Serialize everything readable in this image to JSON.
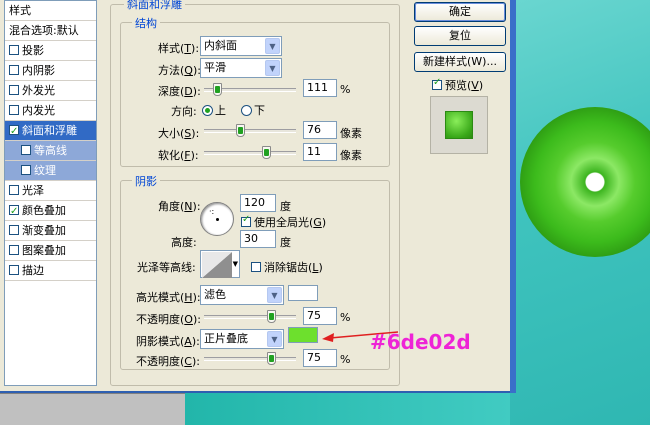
{
  "window": {
    "style_list": [
      {
        "label": "样式",
        "checkbox": null,
        "selected": false,
        "sub": false
      },
      {
        "label": "混合选项:默认",
        "checkbox": null,
        "selected": false,
        "sub": false
      },
      {
        "label": "投影",
        "checkbox": false,
        "selected": false,
        "sub": false
      },
      {
        "label": "内阴影",
        "checkbox": false,
        "selected": false,
        "sub": false
      },
      {
        "label": "外发光",
        "checkbox": false,
        "selected": false,
        "sub": false
      },
      {
        "label": "内发光",
        "checkbox": false,
        "selected": false,
        "sub": false
      },
      {
        "label": "斜面和浮雕",
        "checkbox": true,
        "selected": true,
        "sub": false
      },
      {
        "label": "等高线",
        "checkbox": false,
        "selected": false,
        "sub": true
      },
      {
        "label": "纹理",
        "checkbox": false,
        "selected": false,
        "sub": true
      },
      {
        "label": "光泽",
        "checkbox": false,
        "selected": false,
        "sub": false
      },
      {
        "label": "颜色叠加",
        "checkbox": true,
        "selected": false,
        "sub": false
      },
      {
        "label": "渐变叠加",
        "checkbox": false,
        "selected": false,
        "sub": false
      },
      {
        "label": "图案叠加",
        "checkbox": false,
        "selected": false,
        "sub": false
      },
      {
        "label": "描边",
        "checkbox": false,
        "selected": false,
        "sub": false
      }
    ]
  },
  "bevel": {
    "group_title": "斜面和浮雕",
    "structure_title": "结构",
    "style_label": "样式",
    "style_key": "T",
    "style_value": "内斜面",
    "technique_label": "方法",
    "technique_key": "Q",
    "technique_value": "平滑",
    "depth_label": "深度",
    "depth_key": "D",
    "depth_value": "111",
    "depth_unit": "%",
    "direction_label": "方向:",
    "direction_up": "上",
    "direction_down": "下",
    "direction_selected": "上",
    "size_label": "大小",
    "size_key": "S",
    "size_value": "76",
    "size_unit": "像素",
    "soften_label": "软化",
    "soften_key": "F",
    "soften_value": "11",
    "soften_unit": "像素"
  },
  "shading": {
    "title": "阴影",
    "angle_label": "角度",
    "angle_key": "N",
    "angle_value": "120",
    "angle_unit": "度",
    "global_light_label": "使用全局光",
    "global_light_key": "G",
    "global_light_checked": true,
    "altitude_label": "高度:",
    "altitude_value": "30",
    "altitude_unit": "度",
    "gloss_contour_label": "光泽等高线:",
    "antialias_label": "消除锯齿",
    "antialias_key": "L",
    "antialias_checked": false,
    "highlight_mode_label": "高光模式",
    "highlight_mode_key": "H",
    "highlight_mode_value": "滤色",
    "highlight_color": "#ffffff",
    "highlight_opacity_label": "不透明度",
    "highlight_opacity_key": "O",
    "highlight_opacity_value": "75",
    "highlight_opacity_unit": "%",
    "shadow_mode_label": "阴影模式",
    "shadow_mode_key": "A",
    "shadow_mode_value": "正片叠底",
    "shadow_color": "#6de02d",
    "shadow_opacity_label": "不透明度",
    "shadow_opacity_key": "C",
    "shadow_opacity_value": "75",
    "shadow_opacity_unit": "%"
  },
  "buttons": {
    "ok": "确定",
    "reset": "复位",
    "new_style": "新建样式(W)...",
    "preview_label": "预览",
    "preview_key": "V",
    "preview_checked": true
  },
  "annotation": {
    "text": "#6de02d",
    "color": "#ee23d6"
  },
  "colors": {
    "accent": "#316ac5",
    "dialog_bg": "#ece9d8",
    "group_title": "#0046d5",
    "donut_green": "#3cbb1c"
  },
  "sliders": {
    "depth": 0.111,
    "size": 0.38,
    "soften": 0.69,
    "highlight_opacity": 0.75,
    "shadow_opacity": 0.75
  }
}
